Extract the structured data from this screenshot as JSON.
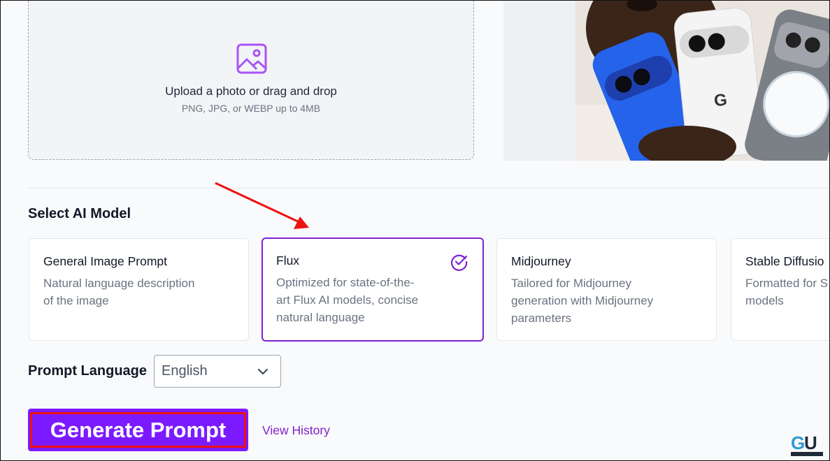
{
  "upload": {
    "title": "Upload a photo or drag and drop",
    "subtitle": "PNG, JPG, or WEBP up to 4MB",
    "icon": "image-icon"
  },
  "model_section": {
    "title": "Select AI Model",
    "cards": [
      {
        "name": "General Image Prompt",
        "desc_lines": [
          "Natural language description",
          "of the image"
        ],
        "selected": false
      },
      {
        "name": "Flux",
        "desc_lines": [
          "Optimized for state-of-the-",
          "art Flux AI models, concise",
          "natural language"
        ],
        "selected": true
      },
      {
        "name": "Midjourney",
        "desc_lines": [
          "Tailored for Midjourney",
          "generation with Midjourney",
          "parameters"
        ],
        "selected": false
      },
      {
        "name": "Stable Diffusio",
        "desc_lines": [
          "Formatted for S",
          "models"
        ],
        "selected": false
      }
    ]
  },
  "language": {
    "label": "Prompt Language",
    "selected": "English"
  },
  "actions": {
    "generate_label": "Generate Prompt",
    "history_label": "View History"
  },
  "colors": {
    "accent": "#7e22ce",
    "button": "#7c1aff",
    "annotation": "#ee1111"
  }
}
